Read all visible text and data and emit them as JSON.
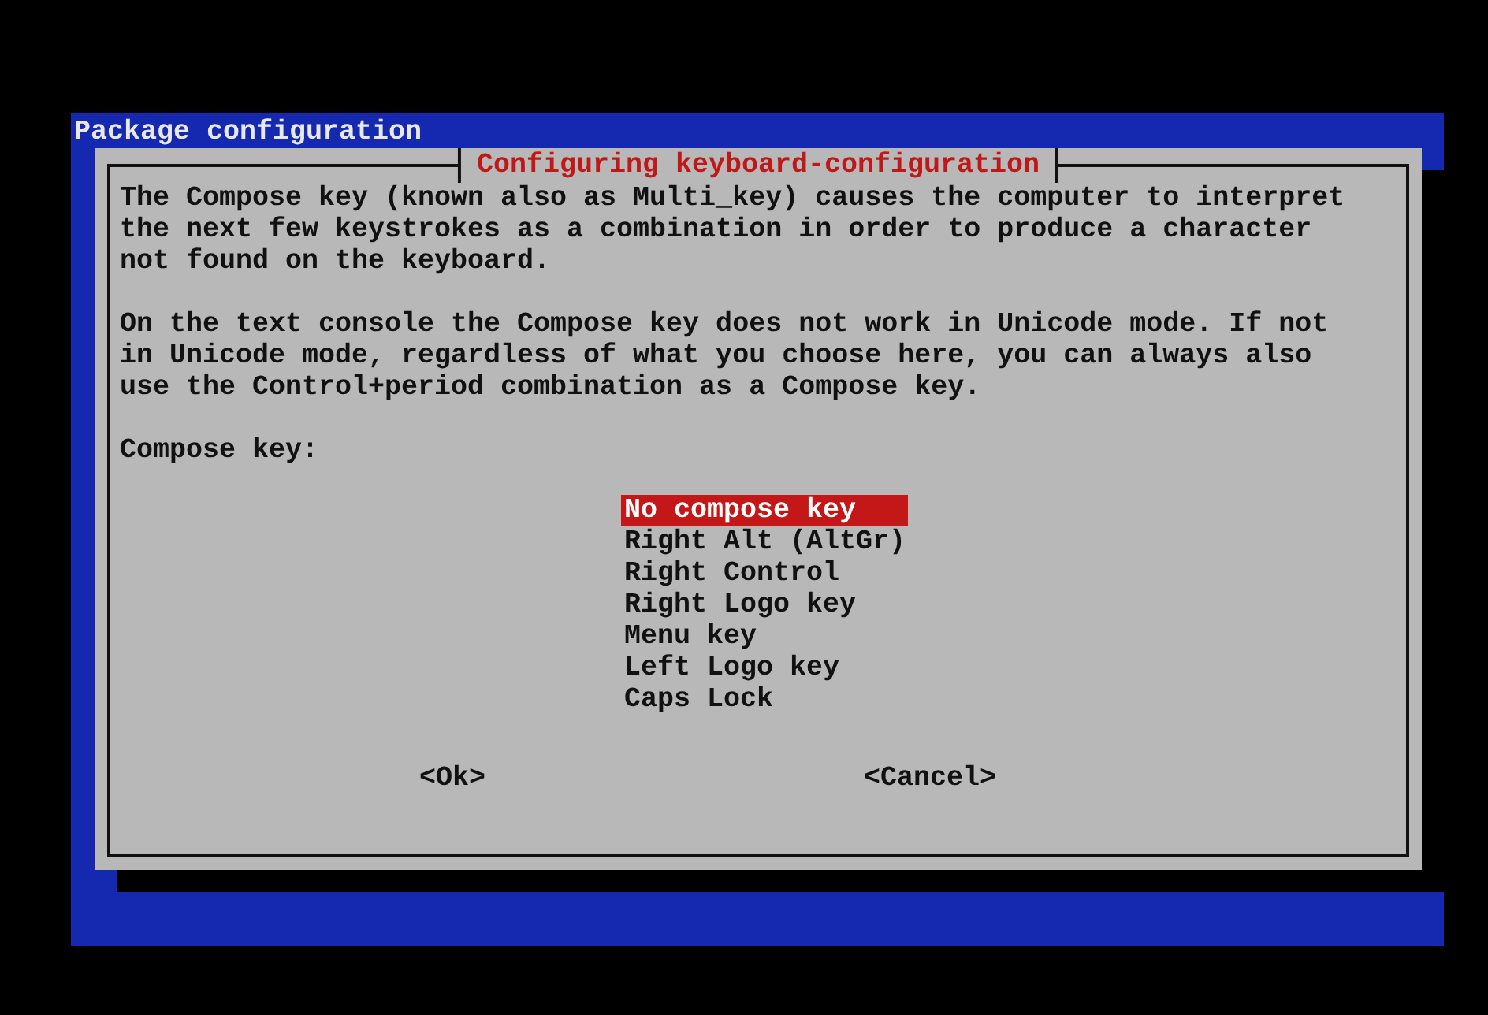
{
  "window": {
    "title": "Package configuration"
  },
  "dialog": {
    "title": "Configuring keyboard-configuration",
    "paragraphs": [
      "The Compose key (known also as Multi_key) causes the computer to interpret the next few keystrokes as a combination in order to produce a character not found on the keyboard.",
      "On the text console the Compose key does not work in Unicode mode. If not in Unicode mode, regardless of what you choose here, you can always also use the Control+period combination as a Compose key."
    ],
    "prompt": "Compose key:",
    "options": [
      {
        "label": "No compose key",
        "selected": true
      },
      {
        "label": "Right Alt (AltGr)",
        "selected": false
      },
      {
        "label": "Right Control",
        "selected": false
      },
      {
        "label": "Right Logo key",
        "selected": false
      },
      {
        "label": "Menu key",
        "selected": false
      },
      {
        "label": "Left Logo key",
        "selected": false
      },
      {
        "label": "Caps Lock",
        "selected": false
      }
    ],
    "buttons": [
      {
        "label": "<Ok>"
      },
      {
        "label": "<Cancel>"
      }
    ]
  }
}
